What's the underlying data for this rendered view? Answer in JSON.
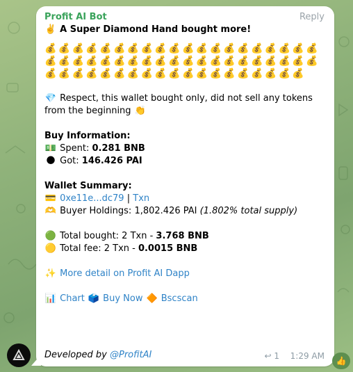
{
  "message": {
    "sender": "Profit AI Bot",
    "reply_label": "Reply",
    "headline_emoji": "✌️",
    "headline": "A Super Diamond Hand bought more!",
    "bag_emoji": "💰",
    "bag_count": 59,
    "respect_emoji": "💎",
    "respect_text": "Respect, this wallet bought only, did not sell any tokens from the beginning",
    "respect_end_emoji": "👏",
    "buy_info": {
      "title": "Buy Information:",
      "spent_emoji": "💵",
      "spent_label": "Spent:",
      "spent_value": "0.281 BNB",
      "got_emoji": "🌑",
      "got_label": "Got:",
      "got_value": "146.426 PAI"
    },
    "wallet": {
      "title": "Wallet Summary:",
      "wallet_emoji": "💳",
      "address": "0xe11e...dc79",
      "separator": "|",
      "txn_link": "Txn",
      "holdings_emoji": "🫶",
      "holdings_label": "Buyer Holdings: 1,802.426 PAI",
      "holdings_note": "(1.802% total supply)"
    },
    "totals": {
      "bought_emoji": "🟢",
      "bought_label": "Total bought: 2 Txn - ",
      "bought_value": "3.768 BNB",
      "fee_emoji": "🟡",
      "fee_label": "Total fee: 2 Txn - ",
      "fee_value": "0.0015 BNB"
    },
    "more_detail": {
      "emoji": "✨",
      "text": "More detail on Profit AI Dapp"
    },
    "links": {
      "chart_emoji": "📊",
      "chart": "Chart",
      "buy_emoji": "🗳️",
      "buy": "Buy Now",
      "bsc_emoji": "🔶",
      "bscscan": "Bscscan"
    },
    "footer": {
      "developed_by": "Developed by ",
      "handle": "@ProfitAI"
    },
    "meta": {
      "reply_count": "1",
      "time": "1:29 AM"
    },
    "reaction_emoji": "👍"
  },
  "colors": {
    "sender": "#3aa35b",
    "link": "#2f83c7",
    "meta": "#8d9ba4"
  }
}
